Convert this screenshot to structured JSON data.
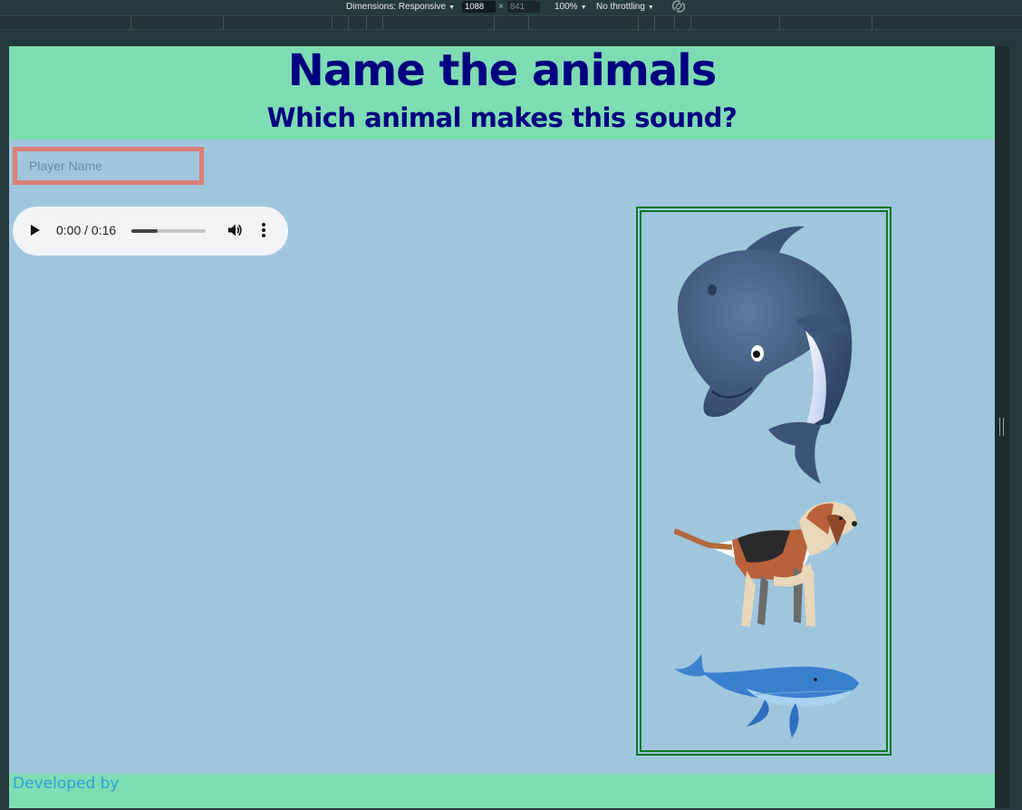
{
  "devtools": {
    "dimensions_label": "Dimensions: Responsive",
    "width": "1088",
    "times": "×",
    "height": "841",
    "zoom": "100%",
    "throttling": "No throttling"
  },
  "page": {
    "title": "Name the animals",
    "subtitle": "Which animal makes this sound?",
    "player_name_placeholder": "Player Name",
    "audio": {
      "time": "0:00 / 0:16",
      "progress": 0.35
    },
    "animals": [
      {
        "name": "dolphin-image",
        "icon": "dolphin"
      },
      {
        "name": "dog-image",
        "icon": "beagle"
      },
      {
        "name": "whale-image",
        "icon": "blue-whale"
      }
    ],
    "footer_text": "Developed by"
  },
  "colors": {
    "page_bg": "#a0c6de",
    "banner_bg": "#7edcb3",
    "heading": "#000080",
    "input_border": "#dc7e78",
    "frame_border": "#0a7a23",
    "footer_link": "#2d9fd8"
  }
}
